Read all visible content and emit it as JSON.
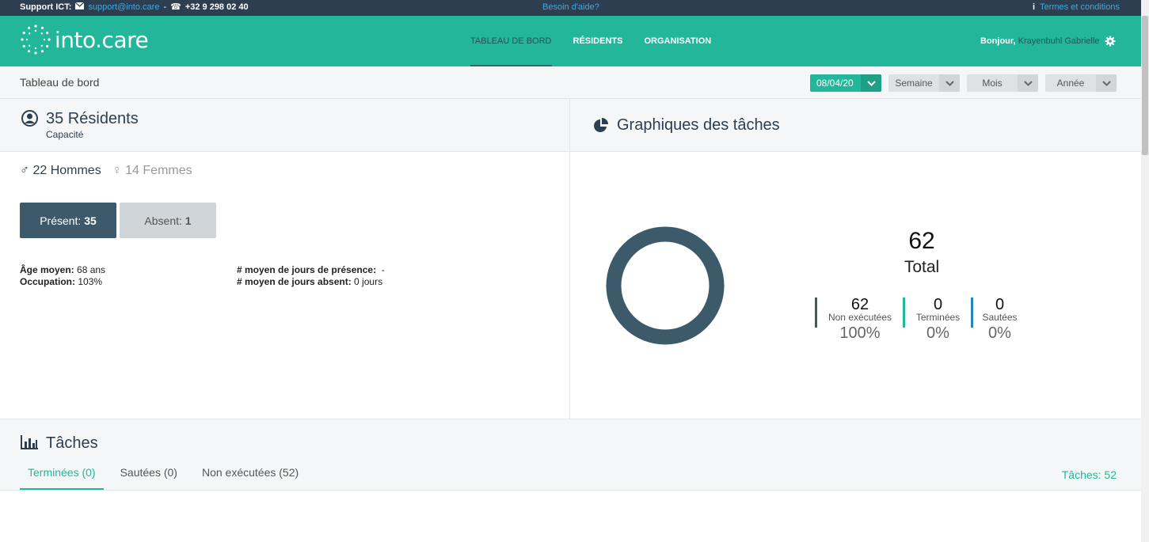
{
  "topbar": {
    "support_label": "Support ICT:",
    "email": "support@into.care",
    "separator": "-",
    "phone": "+32 9 298 02 40",
    "help": "Besoin d'aide?",
    "terms": "Termes et conditions"
  },
  "navbar": {
    "logo_text": "into.care",
    "items": [
      {
        "label": "TABLEAU DE BORD",
        "active": true
      },
      {
        "label": "RÉSIDENTS",
        "active": false
      },
      {
        "label": "ORGANISATION",
        "active": false
      }
    ],
    "greeting": "Bonjour,",
    "user": "Krayenbuhl Gabrielle"
  },
  "breadcrumb": {
    "title": "Tableau de bord",
    "date": "08/04/20",
    "filters": [
      "Semaine",
      "Mois",
      "Année"
    ]
  },
  "residents": {
    "title": "35 Résidents",
    "subtitle": "Capacité",
    "men": "22 Hommes",
    "women": "14 Femmes",
    "present_label": "Présent:",
    "present_value": "35",
    "absent_label": "Absent:",
    "absent_value": "1",
    "age_label": "Âge moyen:",
    "age_value": "68 ans",
    "occupation_label": "Occupation:",
    "occupation_value": "103%",
    "presence_days_label": "# moyen de jours de présence:",
    "presence_days_value": "-",
    "absent_days_label": "# moyen de jours absent:",
    "absent_days_value": "0 jours"
  },
  "task_chart": {
    "title": "Graphiques des tâches",
    "total_value": "62",
    "total_label": "Total",
    "kpis": [
      {
        "value": "62",
        "label": "Non exécutées",
        "pct": "100%",
        "color": "#3d5a6b"
      },
      {
        "value": "0",
        "label": "Terminées",
        "pct": "0%",
        "color": "#22b79a"
      },
      {
        "value": "0",
        "label": "Sautées",
        "pct": "0%",
        "color": "#2685b8"
      }
    ]
  },
  "chart_data": {
    "type": "pie",
    "categories": [
      "Non exécutées",
      "Terminées",
      "Sautées"
    ],
    "values": [
      62,
      0,
      0
    ],
    "colors": [
      "#3d5a6b",
      "#22b79a",
      "#2685b8"
    ]
  },
  "tasks": {
    "title": "Tâches",
    "tabs": [
      {
        "label": "Terminées (0)",
        "active": true
      },
      {
        "label": "Sautées (0)",
        "active": false
      },
      {
        "label": "Non exécutées (52)",
        "active": false
      }
    ],
    "count": "Tâches: 52"
  },
  "colors": {
    "brand": "#22b79a",
    "dark": "#2c3e50",
    "slate": "#3d5a6b"
  }
}
